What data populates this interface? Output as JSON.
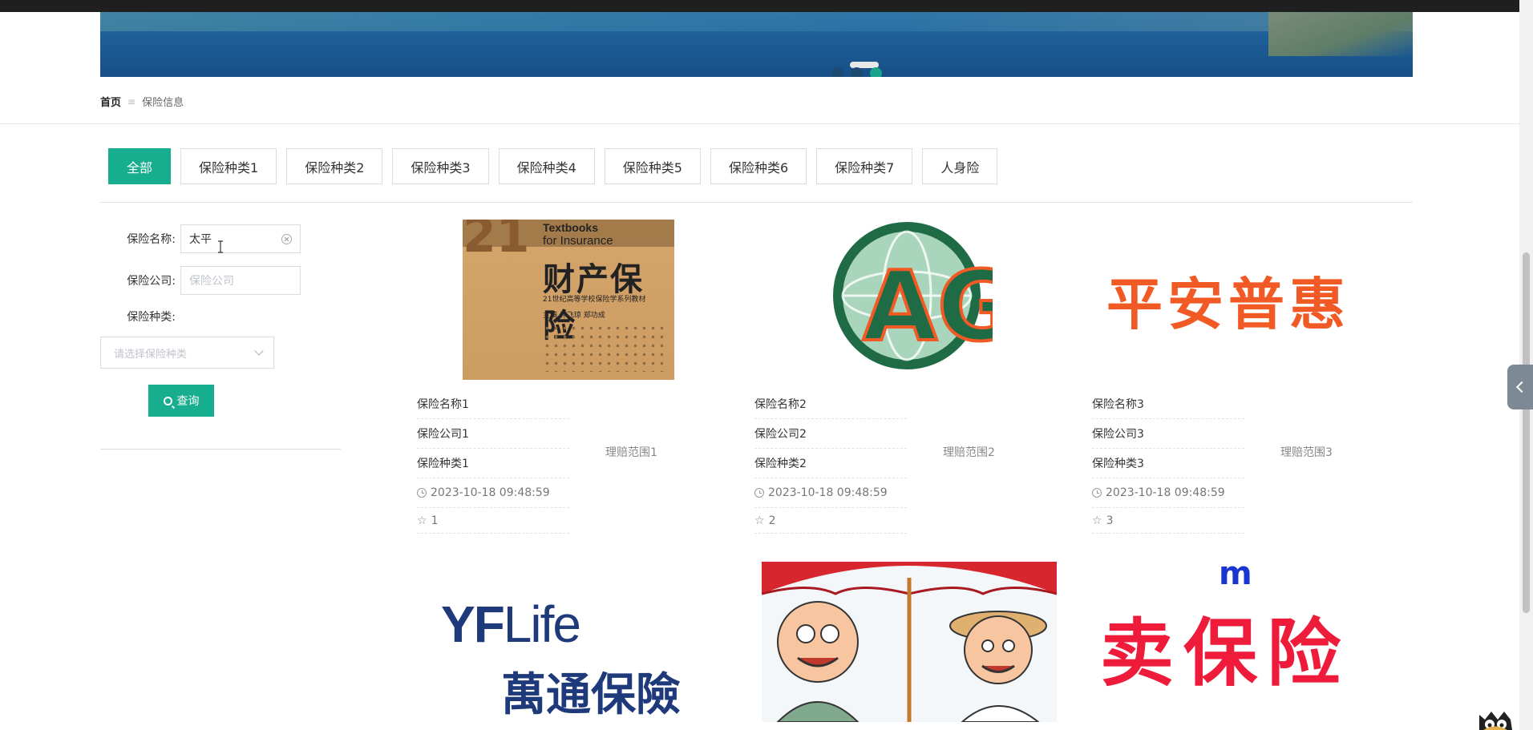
{
  "banner": {
    "dots": 3,
    "active_dot": 3
  },
  "breadcrumb": {
    "home": "首页",
    "separator": "≡",
    "current": "保险信息"
  },
  "tabs": [
    "全部",
    "保险种类1",
    "保险种类2",
    "保险种类3",
    "保险种类4",
    "保险种类5",
    "保险种类6",
    "保险种类7",
    "人身险"
  ],
  "active_tab": 0,
  "filters": {
    "name_label": "保险名称:",
    "name_value": "太平",
    "company_label": "保险公司:",
    "company_placeholder": "保险公司",
    "type_label": "保险种类:",
    "type_placeholder": "请选择保险种类",
    "query_label": "查询"
  },
  "cards": [
    {
      "name": "保险名称1",
      "company": "保险公司1",
      "type": "保险种类1",
      "scope": "理赔范围1",
      "date": "2023-10-18 09:48:59",
      "likes": "1"
    },
    {
      "name": "保险名称2",
      "company": "保险公司2",
      "type": "保险种类2",
      "scope": "理赔范围2",
      "date": "2023-10-18 09:48:59",
      "likes": "2"
    },
    {
      "name": "保险名称3",
      "company": "保险公司3",
      "type": "保险种类3",
      "scope": "理赔范围3",
      "date": "2023-10-18 09:48:59",
      "likes": "3"
    }
  ],
  "images": {
    "book": {
      "line1": "Textbooks",
      "line2": "for Insurance",
      "title": "财产保险",
      "series": "21世纪高等学校保险学系列教材",
      "editors": "主编  许飞琼  郑功成",
      "numeral": "21"
    },
    "ag": "AG",
    "pingan": "平安普惠",
    "yf": {
      "brand_a": "YF",
      "brand_b": "Life",
      "cn": "萬通保險"
    },
    "sell": {
      "top": "m",
      "text": "卖保险"
    }
  },
  "colors": {
    "accent": "#17ad8f",
    "pingan": "#f15a24",
    "yf": "#1f3a7a",
    "sell": "#ee1c3a"
  },
  "icons": [
    "search-icon",
    "clock-icon",
    "star-icon",
    "clear-icon",
    "chevron-down-icon",
    "chevron-left-icon"
  ]
}
